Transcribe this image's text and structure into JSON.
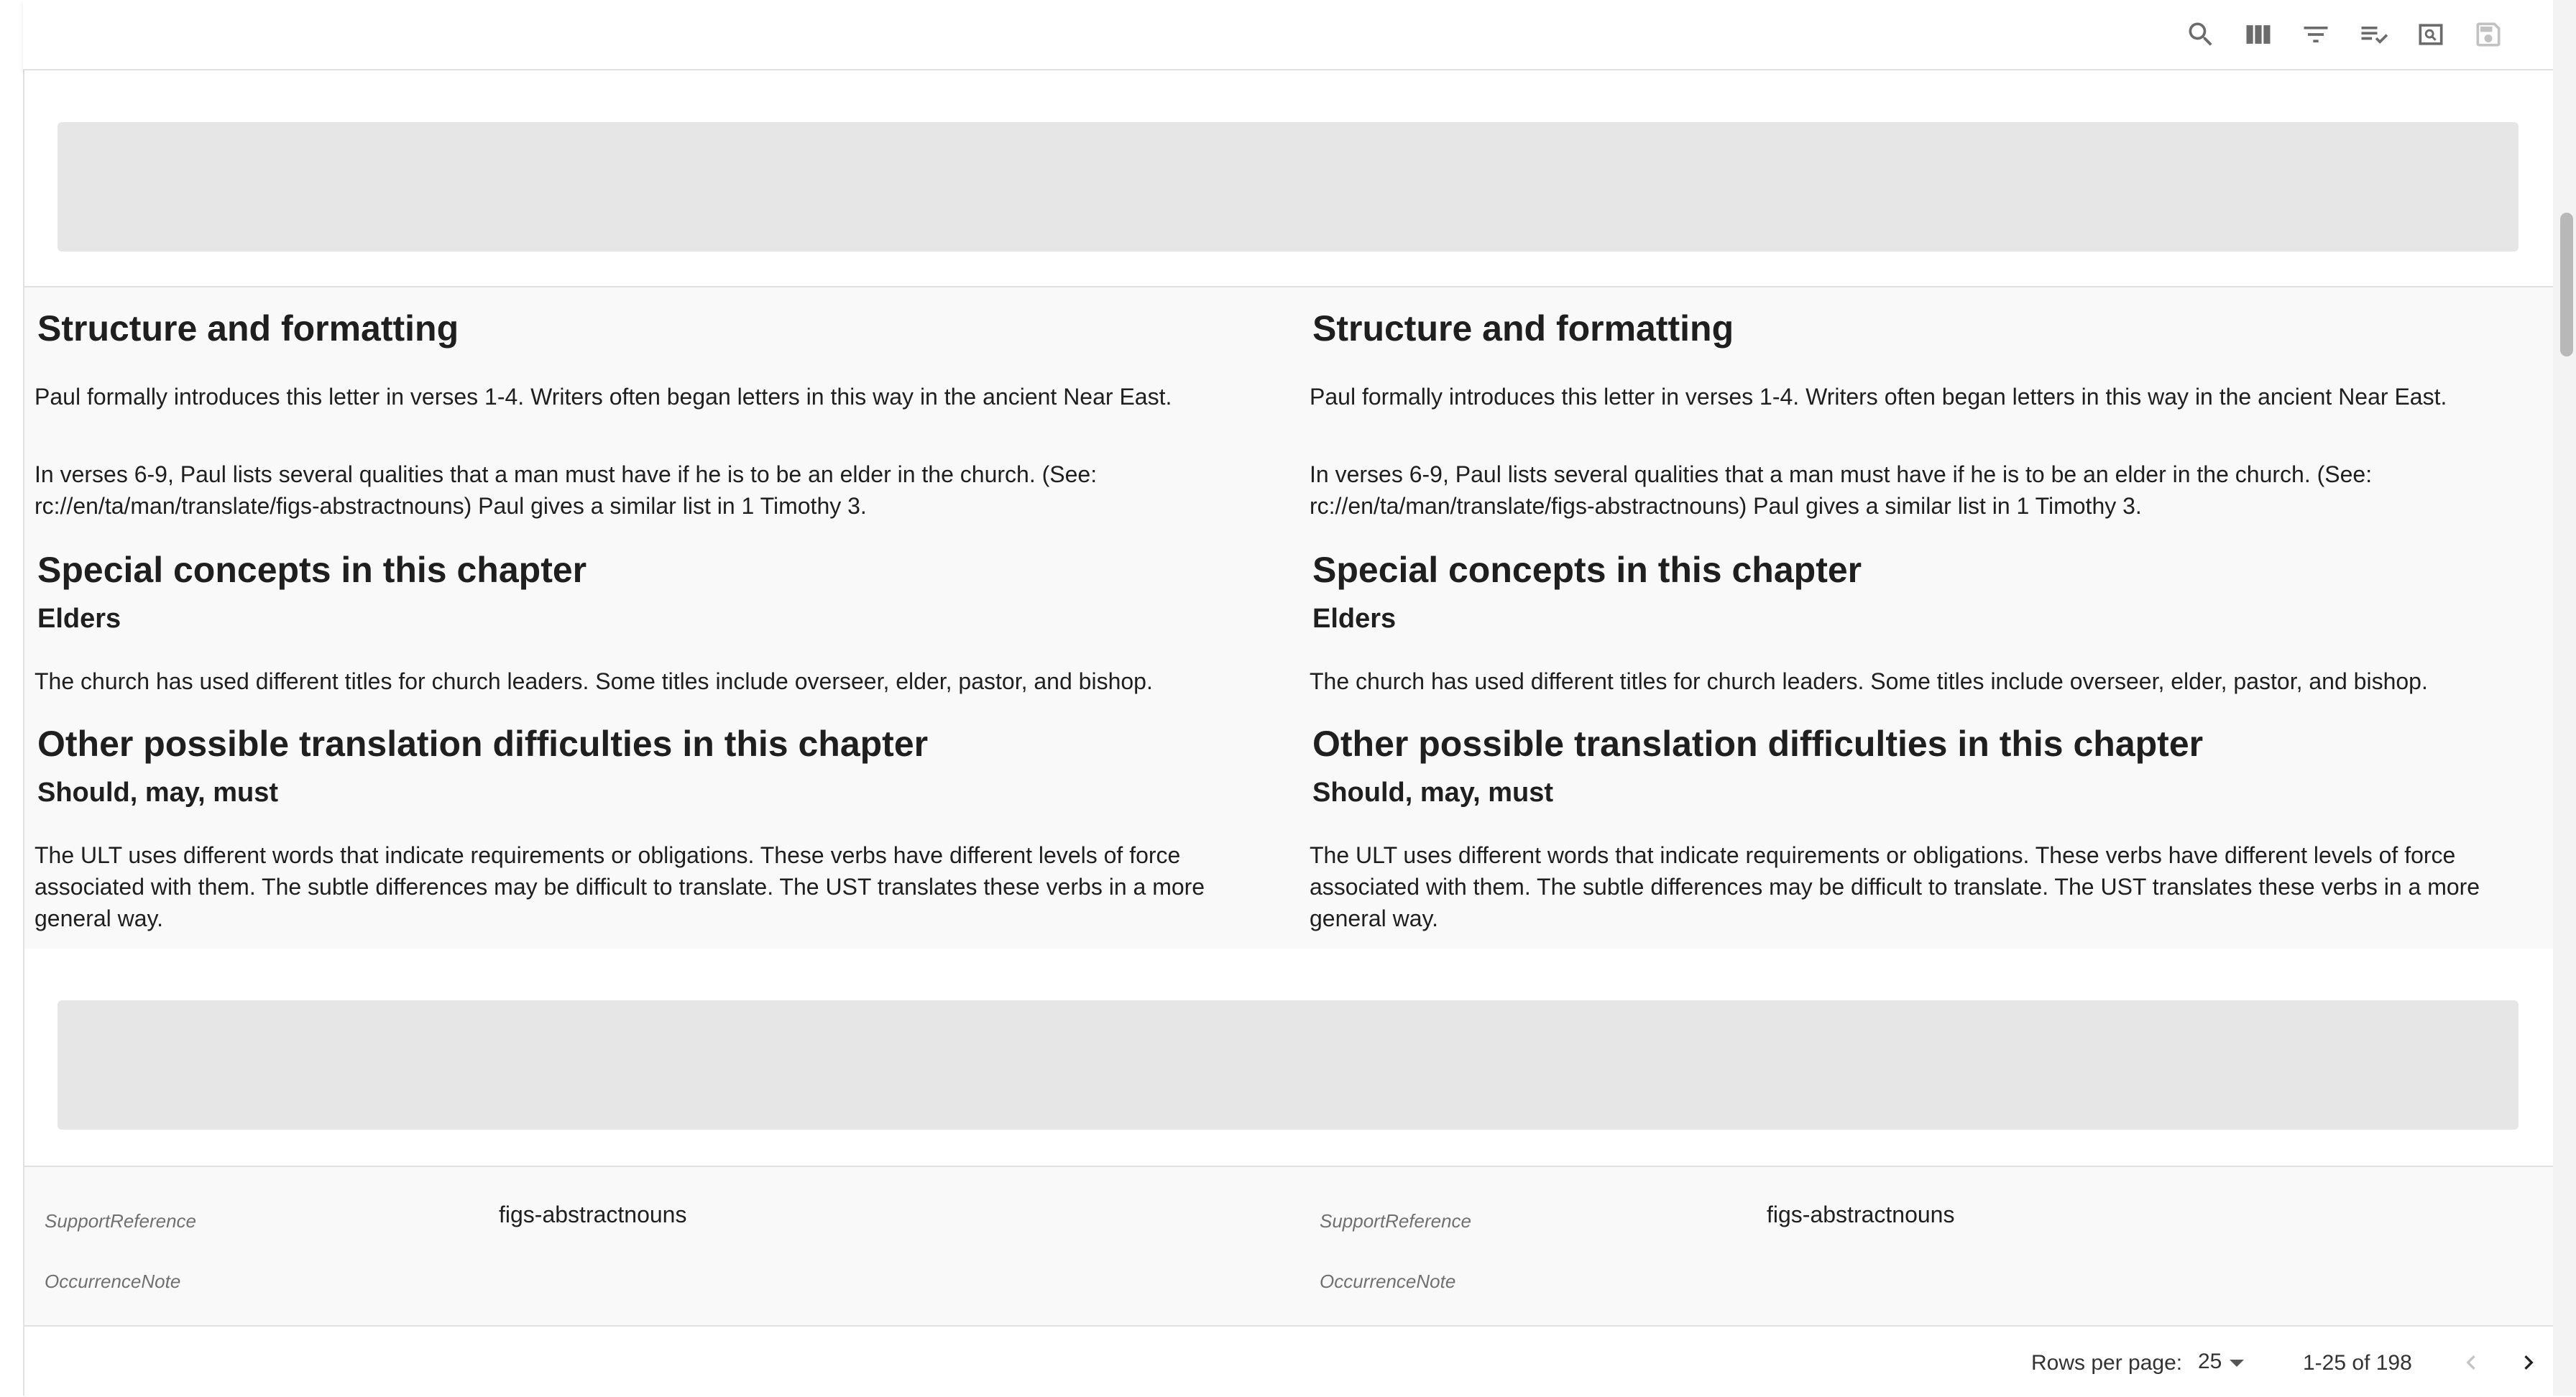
{
  "toolbar": {
    "icons": [
      "search-icon",
      "view-columns-icon",
      "filter-icon",
      "playlist-check-icon",
      "preview-icon",
      "save-icon"
    ]
  },
  "notes": {
    "heading_structure": "Structure and formatting",
    "para_intro": "Paul formally introduces this letter in verses 1-4. Writers often began letters in this way in the ancient Near East.",
    "para_elder_line1": "In verses 6-9, Paul lists several qualities that a man must have if he is to be an elder in the church. (See:",
    "para_elder_line2": "rc://en/ta/man/translate/figs-abstractnouns) Paul gives a similar list in 1 Timothy 3.",
    "heading_special": "Special concepts in this chapter",
    "sub_elders": "Elders",
    "para_church": "The church has used different titles for church leaders. Some titles include overseer, elder, pastor, and bishop.",
    "heading_other": "Other possible translation difficulties in this chapter",
    "sub_should": "Should, may, must",
    "para_ult_line1": "The ULT uses different words that indicate requirements or obligations. These verbs have different levels of force",
    "para_ult_line2": "associated with them. The subtle differences may be difficult to translate. The UST translates these verbs in a more",
    "para_ult_line3": "general way."
  },
  "meta": {
    "support_label": "SupportReference",
    "support_value": "figs-abstractnouns",
    "occurrence_label": "OccurrenceNote"
  },
  "footer": {
    "rows_label": "Rows per page:",
    "rows_value": "25",
    "range": "1-25 of 198"
  }
}
